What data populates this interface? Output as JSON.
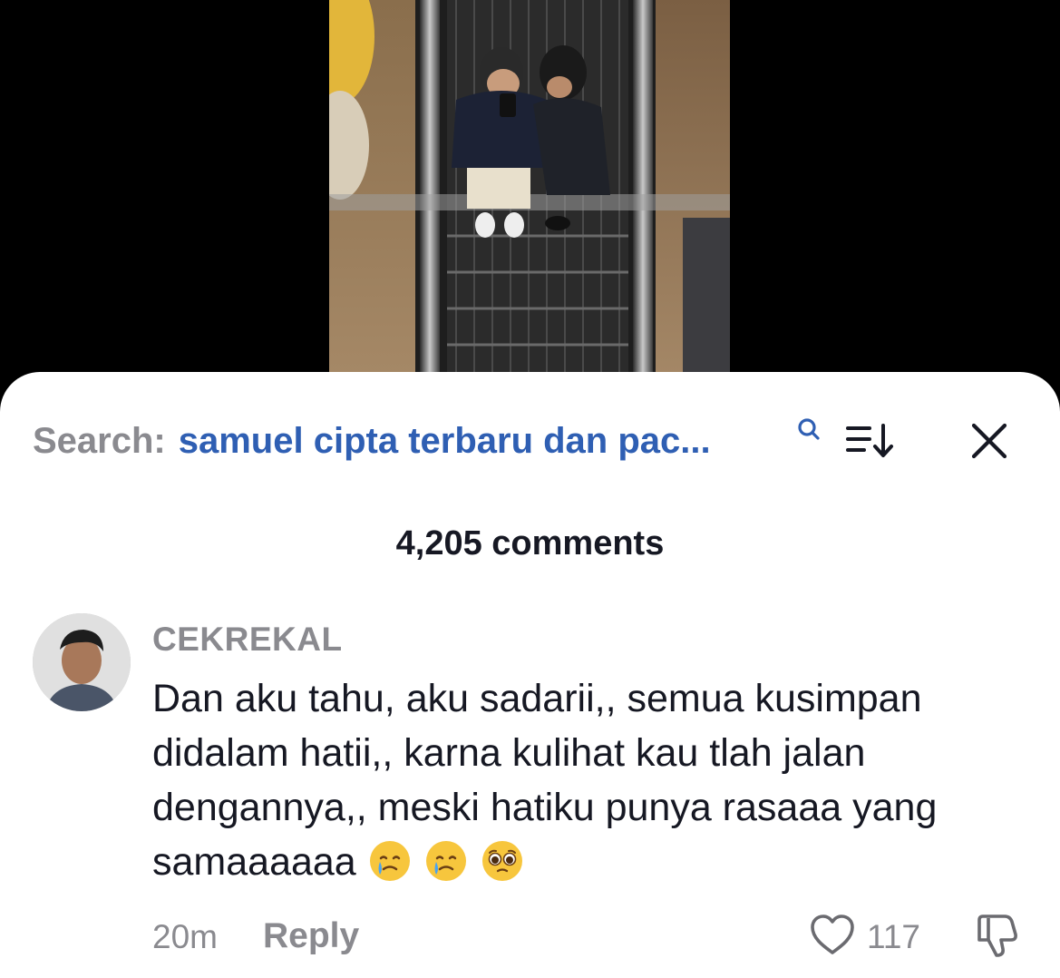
{
  "search": {
    "prefix": "Search:",
    "query": "samuel cipta terbaru dan pac..."
  },
  "comments_header": {
    "count_label": "4,205 comments"
  },
  "comment": {
    "username": "CEKREKAL",
    "text": "Dan aku tahu, aku sadarii,, semua kusimpan didalam hatii,, karna kulihat kau tlah jalan dengannya,, meski hatiku punya rasaaa yang samaaaaaa",
    "emojis": [
      "crying-face-emoji",
      "crying-face-emoji",
      "pleading-face-emoji"
    ],
    "time": "20m",
    "reply_label": "Reply",
    "like_count": "117"
  },
  "icons": {
    "search": "search-icon",
    "sort": "sort-icon",
    "close": "close-icon",
    "like": "heart-icon",
    "dislike": "thumbs-down-icon"
  },
  "colors": {
    "query_blue": "#2f5fb3",
    "muted_gray": "#8a8a8f",
    "text_dark": "#161823",
    "sheet_bg": "#ffffff",
    "backdrop": "#000000"
  }
}
